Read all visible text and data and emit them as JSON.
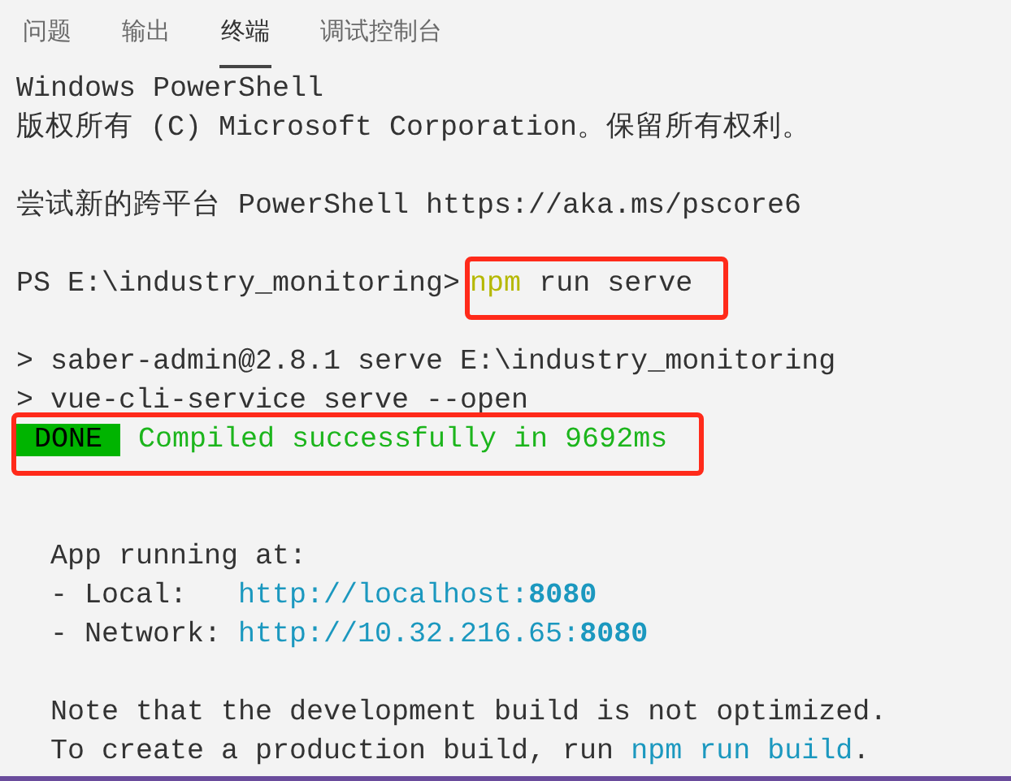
{
  "tabs": [
    {
      "label": "问题",
      "selected": false
    },
    {
      "label": "输出",
      "selected": false
    },
    {
      "label": "终端",
      "selected": true
    },
    {
      "label": "调试控制台",
      "selected": false
    }
  ],
  "terminal": {
    "lines": [
      {
        "kind": "text",
        "segments": [
          {
            "kind": "plain",
            "text": "Windows PowerShell"
          }
        ]
      },
      {
        "kind": "text",
        "segments": [
          {
            "kind": "plain",
            "text": "版权所有 (C) Microsoft Corporation。保留所有权利。"
          }
        ]
      },
      {
        "kind": "blank"
      },
      {
        "kind": "text",
        "segments": [
          {
            "kind": "plain",
            "text": "尝试新的跨平台 PowerShell https://aka.ms/pscore6"
          }
        ]
      },
      {
        "kind": "blank"
      },
      {
        "kind": "text",
        "segments": [
          {
            "kind": "prompt",
            "text": "PS E:\\industry_monitoring>"
          },
          {
            "kind": "command",
            "text": "npm",
            "boxed": true
          },
          {
            "kind": "plain",
            "text": "run serve",
            "boxed": true
          }
        ]
      },
      {
        "kind": "blank"
      },
      {
        "kind": "text",
        "segments": [
          {
            "kind": "plain",
            "text": "> saber-admin@2.8.1 serve E:\\industry_monitoring"
          }
        ]
      },
      {
        "kind": "text",
        "segments": [
          {
            "kind": "plain",
            "text": "> vue-cli-service serve --open"
          }
        ]
      },
      {
        "kind": "text",
        "segments": [
          {
            "kind": "badge",
            "text": "DONE",
            "boxed": true
          },
          {
            "kind": "success",
            "text": "Compiled successfully in 9692ms",
            "boxed": true
          }
        ]
      },
      {
        "kind": "blank"
      },
      {
        "kind": "blank"
      },
      {
        "kind": "text",
        "segments": [
          {
            "kind": "plain",
            "text": "  App running at:"
          }
        ]
      },
      {
        "kind": "text",
        "segments": [
          {
            "kind": "plain",
            "text": "  - Local:   "
          },
          {
            "kind": "link",
            "text": "http://localhost:**8080**"
          }
        ]
      },
      {
        "kind": "text",
        "segments": [
          {
            "kind": "plain",
            "text": "  - Network: "
          },
          {
            "kind": "link",
            "text": "http://10.32.216.65:**8080**"
          }
        ]
      },
      {
        "kind": "blank"
      },
      {
        "kind": "text",
        "segments": [
          {
            "kind": "plain",
            "text": "  Note that the development build is not optimized."
          }
        ]
      },
      {
        "kind": "text",
        "segments": [
          {
            "kind": "plain",
            "text": "  To create a production build, run "
          },
          {
            "kind": "link",
            "text": "npm run build"
          },
          {
            "kind": "plain",
            "text": "."
          }
        ]
      }
    ]
  }
}
